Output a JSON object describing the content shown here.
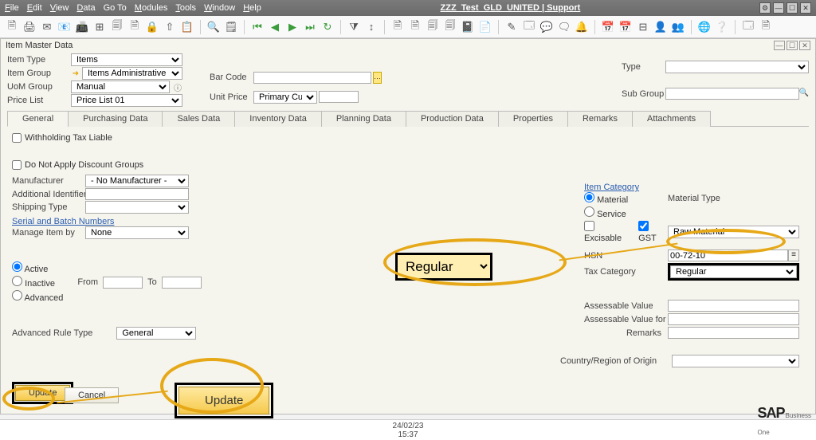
{
  "menubar": {
    "file": "File",
    "edit": "Edit",
    "view": "View",
    "data": "Data",
    "goto": "Go To",
    "modules": "Modules",
    "tools": "Tools",
    "window": "Window",
    "help": "Help",
    "title": "ZZZ_Test_GLD_UNITED | Support"
  },
  "window": {
    "title": "Item Master Data"
  },
  "topform": {
    "item_type_lbl": "Item Type",
    "item_type_val": "Items",
    "item_group_lbl": "Item Group",
    "item_group_val": "Items Administrative",
    "uom_group_lbl": "UoM Group",
    "uom_group_val": "Manual",
    "price_list_lbl": "Price List",
    "price_list_val": "Price List 01",
    "barcode_lbl": "Bar Code",
    "barcode_val": "",
    "unitprice_lbl": "Unit Price",
    "unitprice_val": "Primary Curr",
    "type_lbl": "Type",
    "type_val": "",
    "subgroup_lbl": "Sub Group",
    "subgroup_val": ""
  },
  "tabs": {
    "general": "General",
    "purchasing": "Purchasing Data",
    "sales": "Sales Data",
    "inventory": "Inventory Data",
    "planning": "Planning Data",
    "production": "Production Data",
    "properties": "Properties",
    "remarks": "Remarks",
    "attachments": "Attachments"
  },
  "general": {
    "wht": "Withholding Tax Liable",
    "no_discount": "Do Not Apply Discount Groups",
    "manufacturer_lbl": "Manufacturer",
    "manufacturer_val": "- No Manufacturer -",
    "addid_lbl": "Additional Identifier",
    "addid_val": "",
    "shipping_lbl": "Shipping Type",
    "shipping_val": "",
    "serial_title": "Serial and Batch Numbers",
    "manage_lbl": "Manage Item by",
    "manage_val": "None",
    "active": "Active",
    "inactive": "Inactive",
    "advanced": "Advanced",
    "from": "From",
    "to": "To",
    "adv_rule_lbl": "Advanced Rule Type",
    "adv_rule_val": "General",
    "country_lbl": "Country/Region of Origin"
  },
  "right": {
    "itemcat": "Item Category",
    "material": "Material",
    "service": "Service",
    "matl_type_lbl": "Material Type",
    "matl_type_val": "Raw Material",
    "excisable": "Excisable",
    "gst": "GST",
    "hsn_lbl": "HSN",
    "hsn_val": "00-72-10",
    "taxcat_lbl": "Tax Category",
    "taxcat_val": "Regular",
    "assess_lbl": "Assessable Value",
    "assess_wtr_lbl": "Assessable Value for WTR",
    "remarks_lbl": "Remarks"
  },
  "callout_regular": "Regular",
  "buttons": {
    "update": "Update",
    "cancel": "Cancel",
    "big_update": "Update"
  },
  "status": {
    "date": "24/02/23",
    "time": "15:37",
    "logo1": "SAP",
    "logo2": "Business",
    "logo3": "One"
  }
}
